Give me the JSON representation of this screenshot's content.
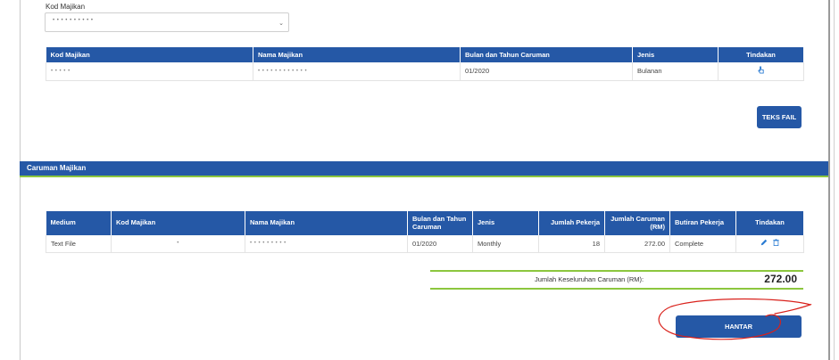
{
  "form": {
    "employer_code_label": "Kod Majikan",
    "employer_code_value": "• • • • • • • • • •"
  },
  "table_top": {
    "headers": [
      "Kod Majikan",
      "Nama Majikan",
      "Bulan dan Tahun Caruman",
      "Jenis",
      "Tindakan"
    ],
    "row": {
      "kod_majikan": "• • • • •",
      "nama_majikan": "• • • • • • • • • • • •",
      "bulan_tahun": "01/2020",
      "jenis": "Bulanan"
    }
  },
  "buttons": {
    "teks_fail": "TEKS FAIL",
    "hantar": "HANTAR"
  },
  "section": {
    "title": "Caruman Majikan"
  },
  "table_bottom": {
    "headers": [
      "Medium",
      "Kod Majikan",
      "Nama Majikan",
      "Bulan dan Tahun Caruman",
      "Jenis",
      "Jumlah Pekerja",
      "Jumlah Caruman (RM)",
      "Butiran Pekerja",
      "Tindakan"
    ],
    "row": {
      "medium": "Text File",
      "kod_majikan": "•",
      "nama_majikan": "• • • • • • • • •",
      "bulan_tahun": "01/2020",
      "jenis": "Monthly",
      "jumlah_pekerja": "18",
      "jumlah_caruman": "272.00",
      "butiran_pekerja": "Complete"
    }
  },
  "total": {
    "label": "Jumlah Keseluruhan Caruman (RM):",
    "value": "272.00"
  },
  "colors": {
    "primary": "#2558a6",
    "accent_green": "#8cc63e",
    "annotation_red": "#d9211b"
  }
}
